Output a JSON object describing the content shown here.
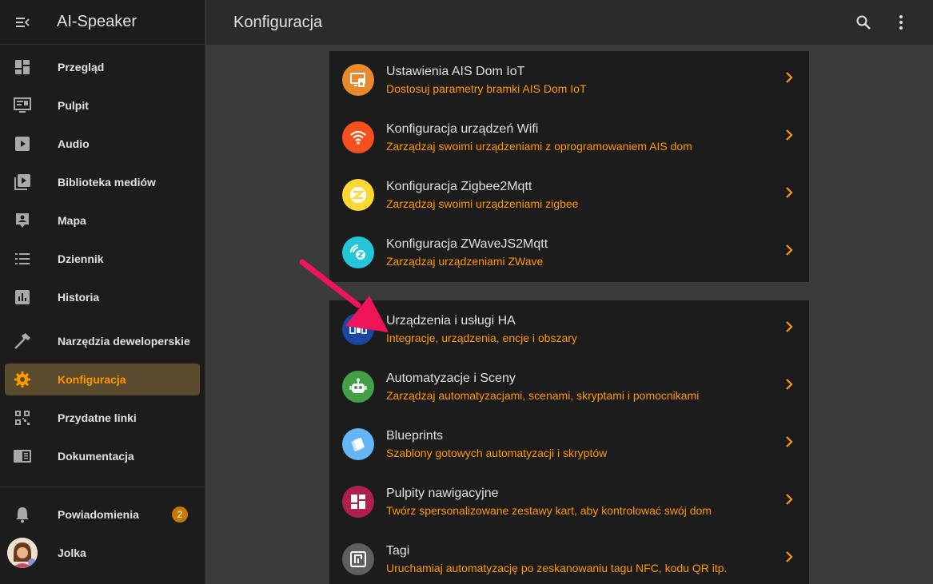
{
  "sidebar": {
    "title": "AI-Speaker",
    "items": [
      {
        "label": "Przegląd",
        "icon": "dashboard-icon"
      },
      {
        "label": "Pulpit",
        "icon": "monitor-icon"
      },
      {
        "label": "Audio",
        "icon": "play-icon"
      },
      {
        "label": "Biblioteka mediów",
        "icon": "media-library-icon"
      },
      {
        "label": "Mapa",
        "icon": "map-account-icon"
      },
      {
        "label": "Dziennik",
        "icon": "list-icon"
      },
      {
        "label": "Historia",
        "icon": "chart-icon"
      },
      {
        "label": "Narzędzia deweloperskie",
        "icon": "hammer-icon"
      },
      {
        "label": "Konfiguracja",
        "icon": "gear-icon"
      },
      {
        "label": "Przydatne linki",
        "icon": "qr-code-icon"
      },
      {
        "label": "Dokumentacja",
        "icon": "book-icon"
      }
    ],
    "notifications": {
      "label": "Powiadomienia",
      "count": "2"
    },
    "user": {
      "label": "Jolka"
    }
  },
  "header": {
    "title": "Konfiguracja"
  },
  "colors": {
    "accent": "#ff9800",
    "active_bg": "#5a4a2e",
    "sidebar_bg": "#1c1c1c",
    "arrow": "#f0145a"
  },
  "cards": [
    {
      "rows": [
        {
          "title": "Ustawienia AIS Dom IoT",
          "subtitle": "Dostosuj parametry bramki AIS Dom IoT",
          "icon": "ais-device-icon",
          "color": "#e8892c"
        },
        {
          "title": "Konfiguracja urządzeń Wifi",
          "subtitle": "Zarządzaj swoimi urządzeniami z oprogramowaniem AIS dom",
          "icon": "wifi-icon",
          "color": "#f4511e"
        },
        {
          "title": "Konfiguracja Zigbee2Mqtt",
          "subtitle": "Zarządzaj swoimi urządzeniami zigbee",
          "icon": "zigbee-icon",
          "color": "#fdd835"
        },
        {
          "title": "Konfiguracja ZWaveJS2Mqtt",
          "subtitle": "Zarządzaj urządzeniami ZWave",
          "icon": "zwave-icon",
          "color": "#26c6da"
        }
      ]
    },
    {
      "rows": [
        {
          "title": "Urządzenia i usługi HA",
          "subtitle": "Integracje, urządzenia, encje i obszary",
          "icon": "devices-icon",
          "color": "#1a47a0"
        },
        {
          "title": "Automatyzacje i Sceny",
          "subtitle": "Zarządzaj automatyzacjami, scenami, skryptami i pomocnikami",
          "icon": "robot-icon",
          "color": "#43a047"
        },
        {
          "title": "Blueprints",
          "subtitle": "Szablony gotowych automatyzacji i skryptów",
          "icon": "blueprint-icon",
          "color": "#64b5f6"
        },
        {
          "title": "Pulpity nawigacyjne",
          "subtitle": "Twórz spersonalizowane zestawy kart, aby kontrolować swój dom",
          "icon": "dashboard-icon",
          "color": "#b0204f"
        },
        {
          "title": "Tagi",
          "subtitle": "Uruchamiaj automatyzację po zeskanowaniu tagu NFC, kodu QR itp.",
          "icon": "tag-icon",
          "color": "#5f5f5f"
        }
      ]
    }
  ]
}
